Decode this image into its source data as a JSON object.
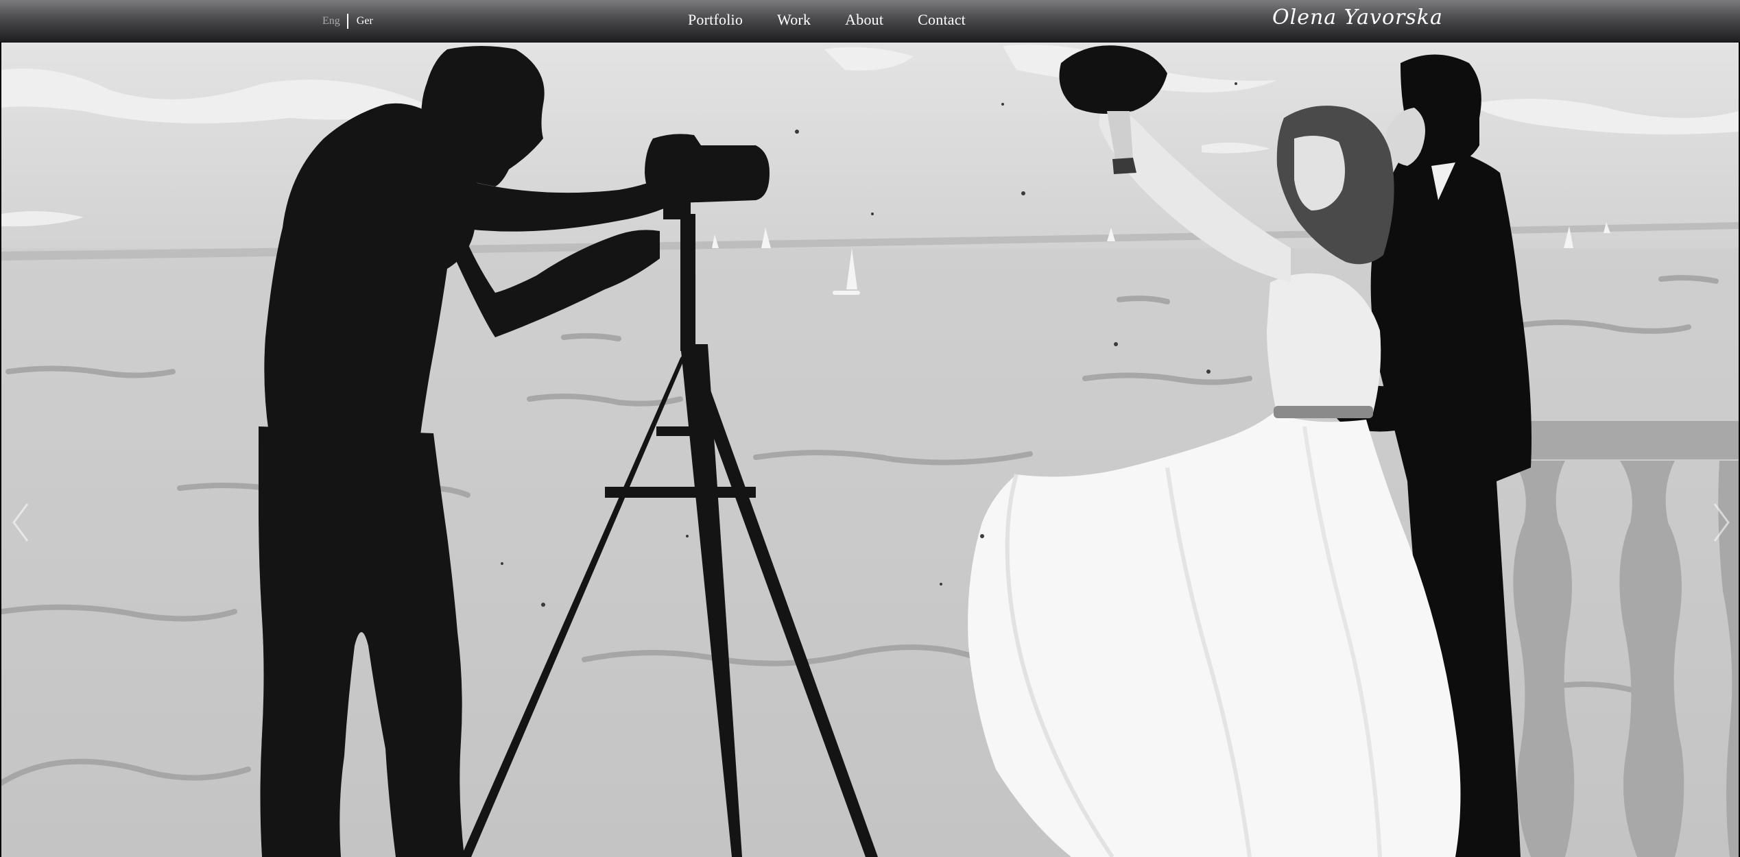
{
  "header": {
    "languages": {
      "active": "Eng",
      "other": "Ger"
    },
    "nav": [
      "Portfolio",
      "Work",
      "About",
      "Contact"
    ],
    "logo_text": "Olena Yavorska"
  },
  "hero": {
    "image_icon": "wedding-photo",
    "prev_icon": "chevron-left-icon",
    "next_icon": "chevron-right-icon"
  },
  "colors": {
    "bar_top": "#7b7b7e",
    "bar_bottom": "#1e1e20",
    "lang_inactive": "#a9a9a9",
    "text": "#ffffff"
  }
}
